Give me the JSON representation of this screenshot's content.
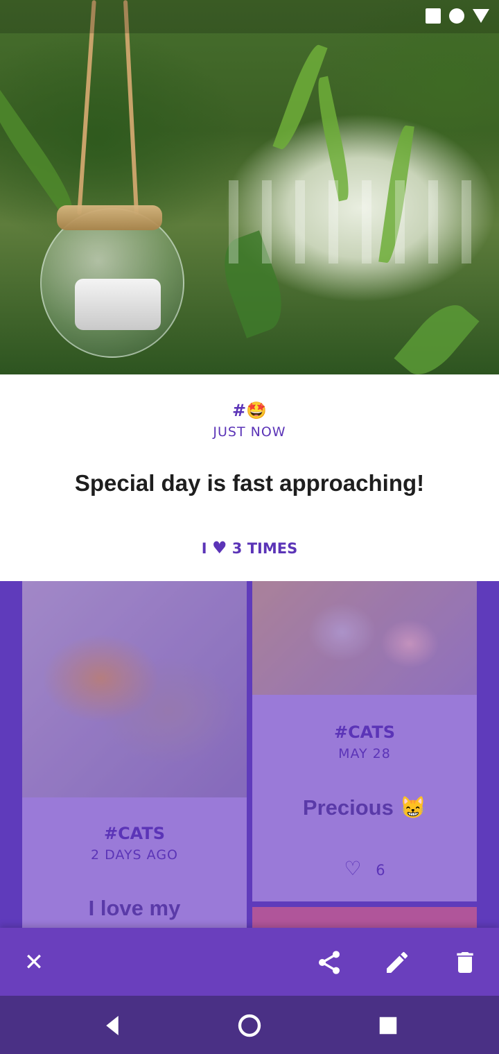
{
  "status_bar": {
    "icons": [
      "square-icon",
      "circle-icon",
      "triangle-icon"
    ]
  },
  "selected_post": {
    "tag": "#🤩",
    "time": "JUST NOW",
    "title": "Special day is fast approaching!",
    "likes_prefix": "I",
    "likes_suffix": "3 TIMES"
  },
  "grid": {
    "posts": [
      {
        "tag": "#CATS",
        "time": "2 DAYS AGO",
        "title": "I love my"
      },
      {
        "tag": "#CATS",
        "time": "MAY 28",
        "title": "Precious 😸",
        "likes": "6"
      }
    ]
  },
  "action_bar": {
    "icons": [
      "close-icon",
      "share-icon",
      "edit-icon",
      "delete-icon"
    ]
  },
  "nav_bar": {
    "icons": [
      "back-icon",
      "home-icon",
      "recents-icon"
    ]
  },
  "colors": {
    "accent": "#5b34b7",
    "bar": "#6a3fbd",
    "nav": "#4a3085"
  }
}
